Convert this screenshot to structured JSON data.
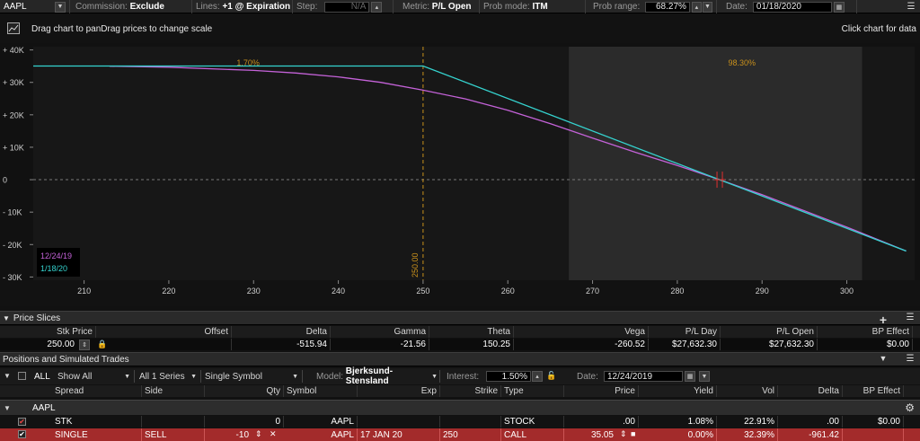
{
  "toolbar": {
    "symbol": "AAPL",
    "commission_label": "Commission:",
    "commission_value": "Exclude",
    "lines_label": "Lines:",
    "lines_value": "+1 @ Expiration",
    "step_label": "Step:",
    "step_value": "N/A",
    "metric_label": "Metric:",
    "metric_value": "P/L Open",
    "probmode_label": "Prob mode:",
    "probmode_value": "ITM",
    "probrange_label": "Prob range:",
    "probrange_value": "68.27%",
    "date_label": "Date:",
    "date_value": "01/18/2020"
  },
  "chart_header": {
    "instructions": "Drag chart to panDrag prices to change scale",
    "click_hint": "Click chart for data"
  },
  "chart_data": {
    "type": "line",
    "xlim": [
      204,
      308
    ],
    "ylim": [
      -31000,
      41000
    ],
    "x_ticks": [
      210,
      220,
      230,
      240,
      250,
      260,
      270,
      280,
      290,
      300
    ],
    "y_ticks": [
      {
        "value": 40000,
        "label": "+ 40K"
      },
      {
        "value": 30000,
        "label": "+ 30K"
      },
      {
        "value": 20000,
        "label": "+ 20K"
      },
      {
        "value": 10000,
        "label": "+ 10K"
      },
      {
        "value": 0,
        "label": "0"
      },
      {
        "value": -10000,
        "label": "- 10K"
      },
      {
        "value": -20000,
        "label": "- 20K"
      },
      {
        "value": -30000,
        "label": "- 30K"
      }
    ],
    "prob_range": [
      267.2,
      301.8
    ],
    "prob_labels": [
      {
        "x": 228,
        "y": 36000,
        "text": "1.70%"
      },
      {
        "x": 286,
        "y": 36000,
        "text": "98.30%"
      }
    ],
    "strike_line": {
      "x": 250,
      "label": "250.00"
    },
    "marker_x": 285,
    "series": [
      {
        "name": "12/24/19",
        "color": "#c462d8",
        "x": [
          213,
          220,
          230,
          235,
          240,
          245,
          250,
          255,
          260,
          265,
          270,
          275,
          280,
          285,
          290,
          295,
          300,
          307
        ],
        "y": [
          35000,
          34700,
          33700,
          32900,
          31700,
          30000,
          27600,
          24900,
          21400,
          17300,
          12800,
          8500,
          4400,
          0,
          -4600,
          -9600,
          -14600,
          -22000
        ]
      },
      {
        "name": "1/18/20",
        "color": "#35d3cf",
        "x": [
          204,
          250,
          285,
          307
        ],
        "y": [
          35050,
          35050,
          0,
          -22000
        ]
      }
    ],
    "grid": false,
    "legend_position": "bottom-left"
  },
  "price_slices": {
    "title": "Price Slices",
    "headers": [
      "Stk Price",
      "Offset",
      "Delta",
      "Gamma",
      "Theta",
      "Vega",
      "P/L Day",
      "P/L Open",
      "BP Effect"
    ],
    "row": [
      "250.00",
      "",
      "-515.94",
      "-21.56",
      "150.25",
      "-260.52",
      "$27,632.30",
      "$27,632.30",
      "$0.00"
    ]
  },
  "positions": {
    "title": "Positions and Simulated Trades",
    "all_label": "ALL",
    "show_filter": "Show All",
    "series_filter": "All 1 Series",
    "symbol_filter": "Single Symbol",
    "model_label": "Model:",
    "model_value": "Bjerksund-Stensland",
    "interest_label": "Interest:",
    "interest_value": "1.50%",
    "date_label": "Date:",
    "date_value": "12/24/2019",
    "headers": [
      "Spread",
      "Side",
      "Qty",
      "Symbol",
      "Exp",
      "Strike",
      "Type",
      "Price",
      "Yield",
      "Vol",
      "Delta",
      "BP Effect"
    ],
    "group": "AAPL",
    "rows": [
      {
        "spread": "STK",
        "side": "",
        "qty": "0",
        "symbol": "AAPL",
        "exp": "",
        "strike": "",
        "type": "STOCK",
        "price": ".00",
        "yield": "1.08%",
        "vol": "22.91%",
        "delta": ".00",
        "bp": "$0.00"
      },
      {
        "spread": "SINGLE",
        "side": "SELL",
        "qty": "-10",
        "symbol": "AAPL",
        "exp": "17 JAN 20",
        "strike": "250",
        "type": "CALL",
        "price": "35.05",
        "yield": "0.00%",
        "vol": "32.39%",
        "delta": "-961.42",
        "bp": ""
      }
    ]
  }
}
